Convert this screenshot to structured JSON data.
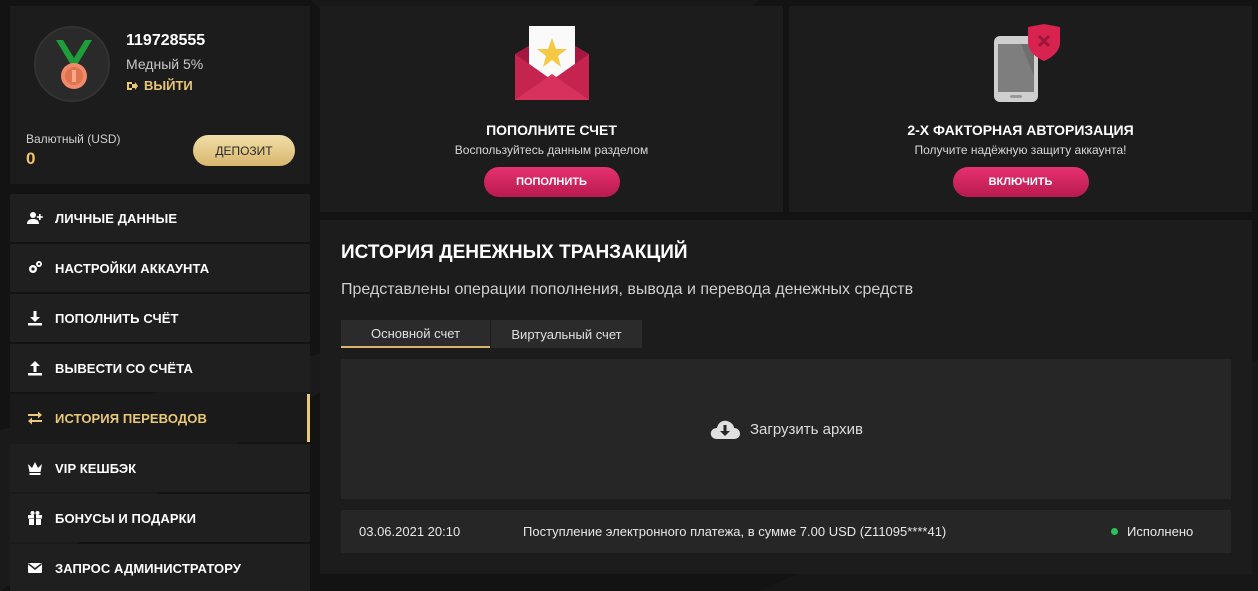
{
  "profile": {
    "user_id": "119728555",
    "rank": "Медный 5%",
    "logout_label": "ВЫЙТИ",
    "currency_label": "Валютный (USD)",
    "balance": "0",
    "deposit_label": "ДЕПОЗИТ"
  },
  "menu": {
    "items": [
      {
        "label": "ЛИЧНЫЕ ДАННЫЕ",
        "icon": "user-plus-icon"
      },
      {
        "label": "НАСТРОЙКИ АККАУНТА",
        "icon": "gears-icon"
      },
      {
        "label": "ПОПОЛНИТЬ СЧЁТ",
        "icon": "download-icon"
      },
      {
        "label": "ВЫВЕСТИ СО СЧЁТА",
        "icon": "upload-icon"
      },
      {
        "label": "ИСТОРИЯ ПЕРЕВОДОВ",
        "icon": "exchange-icon",
        "active": true
      },
      {
        "label": "VIP КЕШБЭК",
        "icon": "crown-icon"
      },
      {
        "label": "БОНУСЫ И ПОДАРКИ",
        "icon": "gift-icon"
      },
      {
        "label": "ЗАПРОС АДМИНИСТРАТОРУ",
        "icon": "envelope-icon"
      }
    ]
  },
  "cards": {
    "deposit": {
      "title": "ПОПОЛНИТЕ СЧЕТ",
      "subtitle": "Воспользуйтесь данным разделом",
      "button": "ПОПОЛНИТЬ"
    },
    "twofa": {
      "title": "2-Х ФАКТОРНАЯ АВТОРИЗАЦИЯ",
      "subtitle": "Получите надёжную защиту аккаунта!",
      "button": "ВКЛЮЧИТЬ"
    }
  },
  "transactions": {
    "title": "ИСТОРИЯ ДЕНЕЖНЫХ ТРАНЗАКЦИЙ",
    "subtitle": "Представлены операции пополнения, вывода и перевода денежных средств",
    "tabs": [
      {
        "label": "Основной счет",
        "active": true
      },
      {
        "label": "Виртуальный счет",
        "active": false
      }
    ],
    "archive_label": "Загрузить архив",
    "rows": [
      {
        "date": "03.06.2021 20:10",
        "description": "Поступление электронного платежа, в сумме 7.00 USD (Z11095****41)",
        "status": "Исполнено"
      }
    ]
  },
  "colors": {
    "accent_gold": "#e9c877",
    "accent_pink": "#d4235f",
    "status_ok": "#2cbf5e"
  }
}
